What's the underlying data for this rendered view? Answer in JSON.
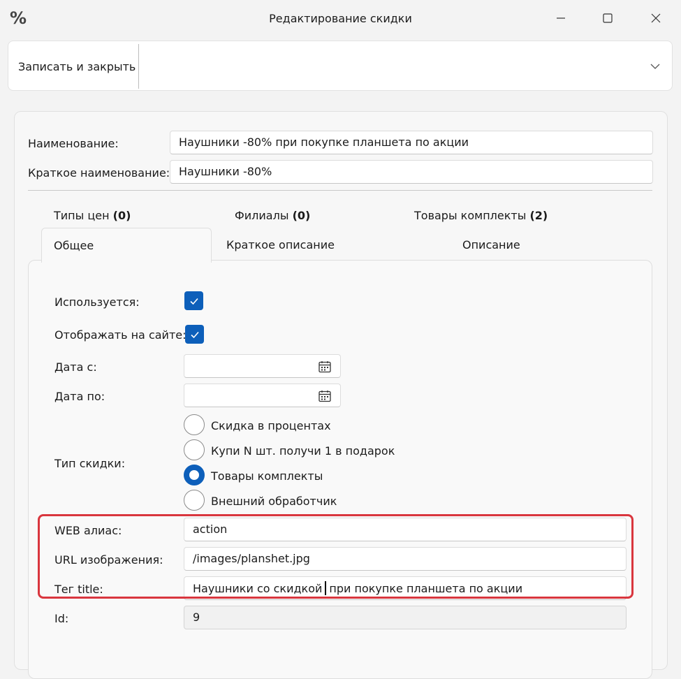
{
  "window": {
    "icon_glyph": "%",
    "title": "Редактирование скидки",
    "controls": [
      "minimize-icon",
      "maximize-icon",
      "close-icon"
    ]
  },
  "toolbar": {
    "save_close_label": "Записать и закрыть",
    "overflow_icon": "chevron-down-icon"
  },
  "header_fields": {
    "name_label": "Наименование:",
    "name_value": "Наушники -80% при покупке планшета по акции",
    "short_name_label": "Краткое наименование:",
    "short_name_value": "Наушники -80%"
  },
  "tabs": {
    "row1": [
      {
        "label": "Типы цен",
        "count": "(0)"
      },
      {
        "label": "Филиалы",
        "count": "(0)"
      },
      {
        "label": "Товары комплекты",
        "count": "(2)"
      }
    ],
    "row2": [
      {
        "label": "Общее",
        "active": true
      },
      {
        "label": "Краткое описание",
        "active": false
      },
      {
        "label": "Описание",
        "active": false
      }
    ]
  },
  "general": {
    "used_label": "Используется:",
    "used_checked": true,
    "show_on_site_label": "Отображать на сайте:",
    "show_on_site_checked": true,
    "date_from_label": "Дата с:",
    "date_from_value": "",
    "date_to_label": "Дата по:",
    "date_to_value": "",
    "discount_type_label": "Тип скидки:",
    "discount_types": [
      {
        "label": "Скидка в процентах",
        "selected": false
      },
      {
        "label": "Купи N шт. получи 1 в подарок",
        "selected": false
      },
      {
        "label": "Товары комплекты",
        "selected": true
      },
      {
        "label": "Внешний обработчик",
        "selected": false
      }
    ],
    "web_alias_label": "WEB алиас:",
    "web_alias_value": "action",
    "image_url_label": "URL изображения:",
    "image_url_value": "/images/planshet.jpg",
    "title_tag_label": "Тег title:",
    "title_tag_before_caret": "Наушники со скидкой",
    "title_tag_after_caret": "при покупке планшета по акции",
    "id_label": "Id:",
    "id_value": "9"
  },
  "colors": {
    "accent": "#0d5fba",
    "highlight_border": "#d9363e",
    "window_bg": "#f3f3f3"
  }
}
